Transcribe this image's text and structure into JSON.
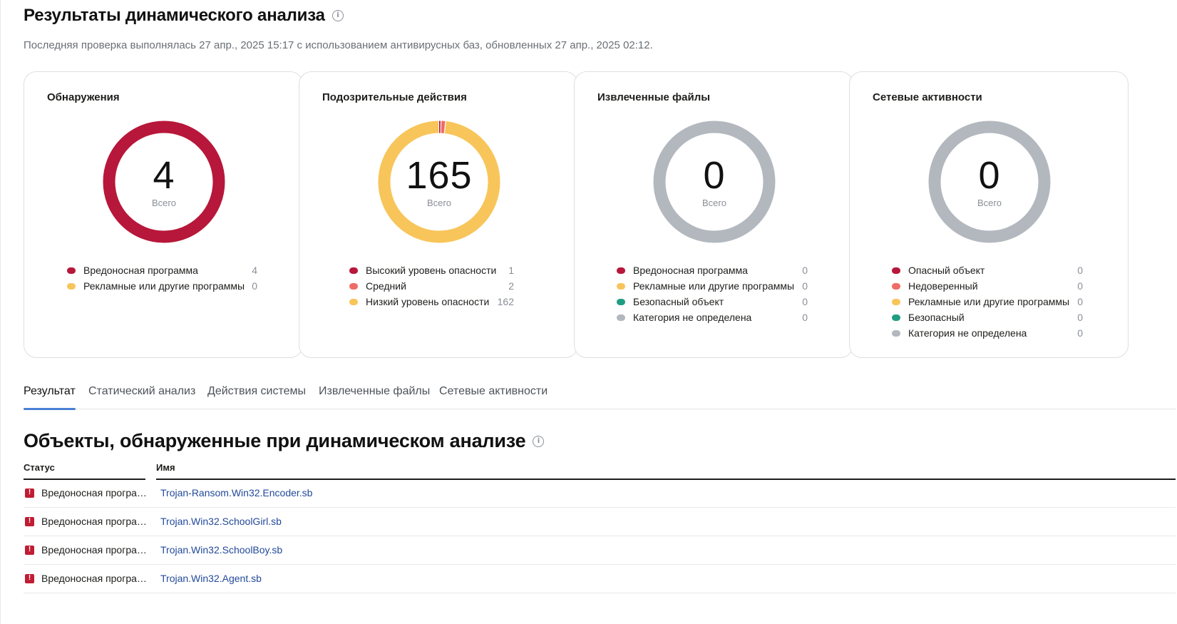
{
  "header": {
    "title": "Результаты динамического анализа",
    "subtitle": "Последняя проверка выполнялась 27 апр., 2025 15:17 с использованием антивирусных баз, обновленных 27 апр., 2025 02:12."
  },
  "cards": [
    {
      "title": "Обнаружения",
      "total": "4",
      "total_label": "Всего",
      "segments": [
        {
          "label": "Вредоносная программа",
          "count": "4",
          "value": 4,
          "color": "#b7173a"
        },
        {
          "label": "Рекламные или другие программы",
          "count": "0",
          "value": 0,
          "color": "#f8c55a"
        }
      ]
    },
    {
      "title": "Подозрительные действия",
      "total": "165",
      "total_label": "Всего",
      "segments": [
        {
          "label": "Высокий уровень опасности",
          "count": "1",
          "value": 1,
          "color": "#b7173a"
        },
        {
          "label": "Средний",
          "count": "2",
          "value": 2,
          "color": "#ee6c65"
        },
        {
          "label": "Низкий уровень опасности",
          "count": "162",
          "value": 162,
          "color": "#f8c55a"
        }
      ]
    },
    {
      "title": "Извлеченные файлы",
      "total": "0",
      "total_label": "Всего",
      "segments": [
        {
          "label": "Вредоносная программа",
          "count": "0",
          "value": 0,
          "color": "#b7173a"
        },
        {
          "label": "Рекламные или другие программы",
          "count": "0",
          "value": 0,
          "color": "#f8c55a"
        },
        {
          "label": "Безопасный объект",
          "count": "0",
          "value": 0,
          "color": "#1f9e82"
        },
        {
          "label": "Категория не определена",
          "count": "0",
          "value": 0,
          "color": "#b3b8bf"
        }
      ]
    },
    {
      "title": "Сетевые активности",
      "total": "0",
      "total_label": "Всего",
      "segments": [
        {
          "label": "Опасный объект",
          "count": "0",
          "value": 0,
          "color": "#b7173a"
        },
        {
          "label": "Недоверенный",
          "count": "0",
          "value": 0,
          "color": "#ee6c65"
        },
        {
          "label": "Рекламные или другие программы",
          "count": "0",
          "value": 0,
          "color": "#f8c55a"
        },
        {
          "label": "Безопасный",
          "count": "0",
          "value": 0,
          "color": "#1f9e82"
        },
        {
          "label": "Категория не определена",
          "count": "0",
          "value": 0,
          "color": "#b3b8bf"
        }
      ]
    }
  ],
  "colors": {
    "empty_ring": "#b3b8bf",
    "accent_tab": "#4a7fd4",
    "link": "#234a9a",
    "danger": "#c01c32"
  },
  "tabs": [
    {
      "label": "Результат",
      "active": true
    },
    {
      "label": "Статический анализ",
      "active": false
    },
    {
      "label": "Действия системы",
      "active": false
    },
    {
      "label": "Извлеченные файлы",
      "active": false
    },
    {
      "label": "Сетевые активности",
      "active": false
    }
  ],
  "objects_section": {
    "title": "Объекты, обнаруженные при динамическом анализе",
    "columns": {
      "status": "Статус",
      "name": "Имя"
    },
    "rows": [
      {
        "status": "Вредоносная программа",
        "status_icon": "alert-icon",
        "name": "Trojan-Ransom.Win32.Encoder.sb"
      },
      {
        "status": "Вредоносная программа",
        "status_icon": "alert-icon",
        "name": "Trojan.Win32.SchoolGirl.sb"
      },
      {
        "status": "Вредоносная программа",
        "status_icon": "alert-icon",
        "name": "Trojan.Win32.SchoolBoy.sb"
      },
      {
        "status": "Вредоносная программа",
        "status_icon": "alert-icon",
        "name": "Trojan.Win32.Agent.sb"
      }
    ]
  }
}
